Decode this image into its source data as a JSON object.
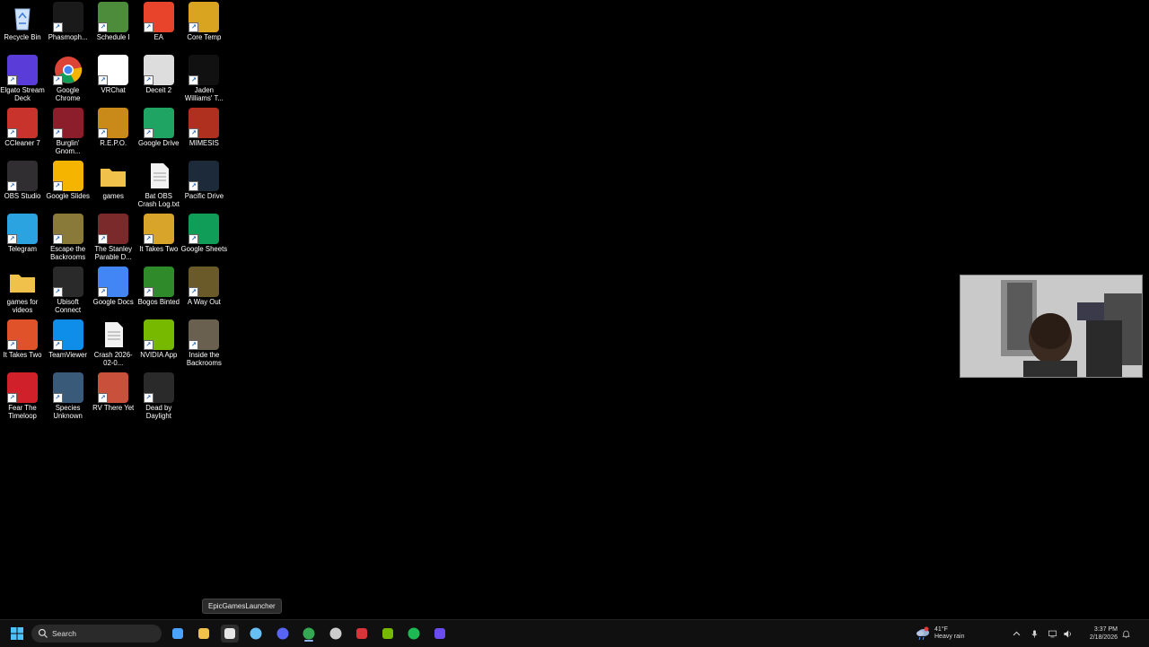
{
  "desktop": {
    "icons": [
      {
        "label": "Recycle Bin",
        "icon": "recycle-bin-icon",
        "color": "#3a7bd5"
      },
      {
        "label": "Phasmoph...",
        "icon": "phasmophobia-icon",
        "color": "#1a1a1a"
      },
      {
        "label": "Schedule I",
        "icon": "schedule-i-icon",
        "color": "#4c8c3a"
      },
      {
        "label": "EA",
        "icon": "ea-icon",
        "color": "#e8432b"
      },
      {
        "label": "Core Temp",
        "icon": "core-temp-icon",
        "color": "#d9a520"
      },
      {
        "label": "Elgato Stream Deck",
        "icon": "stream-deck-icon",
        "color": "#5a3dd8"
      },
      {
        "label": "Google Chrome",
        "icon": "chrome-icon",
        "color": "#34a853"
      },
      {
        "label": "VRChat",
        "icon": "vrchat-icon",
        "color": "#ffffff"
      },
      {
        "label": "Deceit 2",
        "icon": "deceit-icon",
        "color": "#dddddd"
      },
      {
        "label": "Jaden Williams' T...",
        "icon": "stairs-game-icon",
        "color": "#111111"
      },
      {
        "label": "CCleaner 7",
        "icon": "ccleaner-icon",
        "color": "#c8332c"
      },
      {
        "label": "Burglin' Gnom...",
        "icon": "burglin-gnomes-icon",
        "color": "#8b1e2a"
      },
      {
        "label": "R.E.P.O.",
        "icon": "repo-icon",
        "color": "#c98a1a"
      },
      {
        "label": "Google Drive",
        "icon": "google-drive-icon",
        "color": "#1fa463"
      },
      {
        "label": "MIMESIS",
        "icon": "mimesis-icon",
        "color": "#b0301f"
      },
      {
        "label": "OBS Studio",
        "icon": "obs-icon",
        "color": "#302e31"
      },
      {
        "label": "Google Slides",
        "icon": "google-slides-icon",
        "color": "#f4b400"
      },
      {
        "label": "games",
        "icon": "folder-icon",
        "color": "#f0c24b"
      },
      {
        "label": "Bat OBS Crash Log.txt",
        "icon": "text-file-icon",
        "color": "#f2f2f2"
      },
      {
        "label": "Pacific Drive",
        "icon": "pacific-drive-icon",
        "color": "#1d2a3a"
      },
      {
        "label": "Telegram",
        "icon": "telegram-icon",
        "color": "#2aa3e0"
      },
      {
        "label": "Escape the Backrooms",
        "icon": "escape-backrooms-icon",
        "color": "#8a7a3a"
      },
      {
        "label": "The Stanley Parable D...",
        "icon": "stanley-parable-icon",
        "color": "#7a2a2a"
      },
      {
        "label": "It Takes Two",
        "icon": "it-takes-two-icon",
        "color": "#d8a52a"
      },
      {
        "label": "Google Sheets",
        "icon": "google-sheets-icon",
        "color": "#0f9d58"
      },
      {
        "label": "games for videos",
        "icon": "folder-icon",
        "color": "#f0c24b"
      },
      {
        "label": "Ubisoft Connect",
        "icon": "ubisoft-icon",
        "color": "#2a2a2a"
      },
      {
        "label": "Google Docs",
        "icon": "google-docs-icon",
        "color": "#4285f4"
      },
      {
        "label": "Bogos Binted",
        "icon": "bogos-binted-icon",
        "color": "#2f8a2a"
      },
      {
        "label": "A Way Out",
        "icon": "a-way-out-icon",
        "color": "#6a5a2a"
      },
      {
        "label": "It Takes Two",
        "icon": "it-takes-two-icon",
        "color": "#e0532a"
      },
      {
        "label": "TeamViewer",
        "icon": "teamviewer-icon",
        "color": "#0e8ee9"
      },
      {
        "label": "Crash 2026-02-0...",
        "icon": "text-file-icon",
        "color": "#f2f2f2"
      },
      {
        "label": "NVIDIA App",
        "icon": "nvidia-icon",
        "color": "#76b900"
      },
      {
        "label": "Inside the Backrooms",
        "icon": "inside-backrooms-icon",
        "color": "#6a6050"
      },
      {
        "label": "Fear The Timeloop",
        "icon": "fear-timeloop-icon",
        "color": "#d0202a"
      },
      {
        "label": "Species Unknown",
        "icon": "species-unknown-icon",
        "color": "#3a5a7a"
      },
      {
        "label": "RV There Yet",
        "icon": "rv-there-yet-icon",
        "color": "#c9503a"
      },
      {
        "label": "Dead by Daylight",
        "icon": "dead-by-daylight-icon",
        "color": "#2a2a2a"
      }
    ]
  },
  "webcam": {
    "label": "webcam-overlay"
  },
  "tooltip": {
    "text": "EpicGamesLauncher"
  },
  "taskbar": {
    "search_placeholder": "Search",
    "apps": [
      {
        "name": "copilot-icon",
        "color": "#4aa3ff"
      },
      {
        "name": "file-explorer-icon",
        "color": "#f0c24b"
      },
      {
        "name": "epic-games-icon",
        "color": "#e6e6e6"
      },
      {
        "name": "steam-icon",
        "color": "#66c0f4"
      },
      {
        "name": "discord-icon",
        "color": "#5865f2"
      },
      {
        "name": "chrome-icon",
        "color": "#34a853"
      },
      {
        "name": "obs-icon",
        "color": "#cccccc"
      },
      {
        "name": "pin-app-icon",
        "color": "#d9343a"
      },
      {
        "name": "nvidia-icon",
        "color": "#76b900"
      },
      {
        "name": "spotify-icon",
        "color": "#1db954"
      },
      {
        "name": "stream-deck-icon",
        "color": "#6b4cf0"
      }
    ],
    "weather": {
      "temp": "41°F",
      "condition": "Heavy rain"
    },
    "clock": {
      "time": "3:37 PM",
      "date": "2/18/2026"
    }
  },
  "colors": {
    "accent": "#8ab4f8",
    "taskbar_bg": "#101010"
  }
}
